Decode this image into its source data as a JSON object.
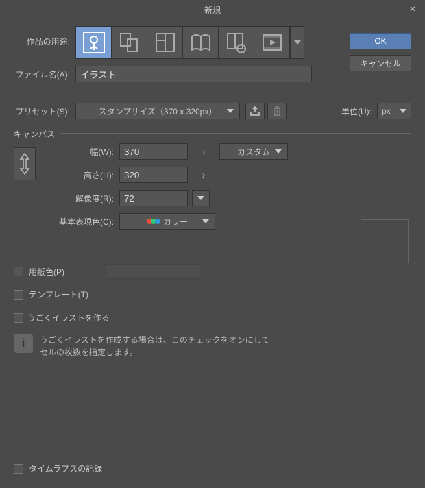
{
  "title": "新規",
  "labels": {
    "purpose": "作品の用途:",
    "filename": "ファイル名(A):",
    "preset": "プリセット(S):",
    "unit": "単位(U):",
    "canvas": "キャンバス",
    "width": "幅(W):",
    "height": "高さ(H):",
    "resolution": "解像度(R):",
    "colorMode": "基本表現色(C):",
    "paperColor": "用紙色(P)",
    "template": "テンプレート(T)",
    "animation": "うごくイラストを作る",
    "timelapse": "タイムラプスの記録"
  },
  "buttons": {
    "ok": "OK",
    "cancel": "キャンセル"
  },
  "values": {
    "filename": "イラスト",
    "preset": "スタンプサイズ（370 x 320px）",
    "unit": "px",
    "width": "370",
    "height": "320",
    "resolution": "72",
    "sizePreset": "カスタム",
    "colorMode": "カラー"
  },
  "info": {
    "line1": "うごくイラストを作成する場合は、このチェックをオンにして",
    "line2": "セルの枚数を指定します。"
  }
}
